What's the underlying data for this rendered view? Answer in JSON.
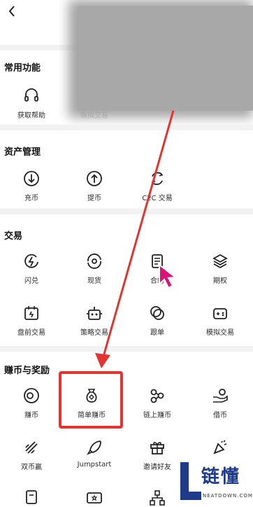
{
  "header": {
    "back_icon": "chevron-left-icon",
    "right_icons": [
      "headset-icon",
      "scan-icon",
      "add-user-icon"
    ]
  },
  "sections": {
    "common": {
      "title": "常用功能",
      "items": [
        {
          "label": "获取帮助",
          "icon": "headset-icon"
        },
        {
          "label": "模拟交易",
          "icon": "simulated-trade-icon"
        },
        {
          "label": "",
          "icon": "blurred-icon"
        },
        {
          "label": "",
          "icon": "blurred-icon"
        }
      ]
    },
    "assets": {
      "title": "资产管理",
      "items": [
        {
          "label": "充币",
          "icon": "deposit-icon"
        },
        {
          "label": "提币",
          "icon": "withdraw-icon"
        },
        {
          "label": "C2C 交易",
          "icon": "c2c-icon"
        }
      ]
    },
    "trade": {
      "title": "交易",
      "items": [
        {
          "label": "闪兑",
          "icon": "flash-swap-icon"
        },
        {
          "label": "现货",
          "icon": "spot-icon"
        },
        {
          "label": "合约",
          "icon": "futures-icon"
        },
        {
          "label": "期权",
          "icon": "options-icon"
        },
        {
          "label": "盘前交易",
          "icon": "premarket-icon"
        },
        {
          "label": "策略交易",
          "icon": "bot-icon"
        },
        {
          "label": "跟单",
          "icon": "copy-trade-icon"
        },
        {
          "label": "模拟交易",
          "icon": "demo-trade-icon"
        }
      ]
    },
    "earn": {
      "title": "赚币与奖励",
      "items": [
        {
          "label": "赚币",
          "icon": "earn-icon"
        },
        {
          "label": "简单赚币",
          "icon": "money-bag-icon"
        },
        {
          "label": "链上赚币",
          "icon": "onchain-earn-icon"
        },
        {
          "label": "借币",
          "icon": "loan-icon"
        },
        {
          "label": "双币赢",
          "icon": "dual-currency-icon"
        },
        {
          "label": "Jumpstart",
          "icon": "rocket-icon"
        },
        {
          "label": "邀请好友",
          "icon": "gift-icon"
        },
        {
          "label": "",
          "icon": "party-icon"
        },
        {
          "label": "",
          "icon": "wallet-icon"
        },
        {
          "label": "",
          "icon": "ticket-icon"
        },
        {
          "label": "",
          "icon": "network-icon"
        }
      ]
    }
  },
  "watermark": {
    "brand": "链懂",
    "domain": "NEATDOWN.COM"
  },
  "colors": {
    "arrow": "#e5332f",
    "cursor": "#e0107a",
    "logo": "#1e3a8a"
  }
}
